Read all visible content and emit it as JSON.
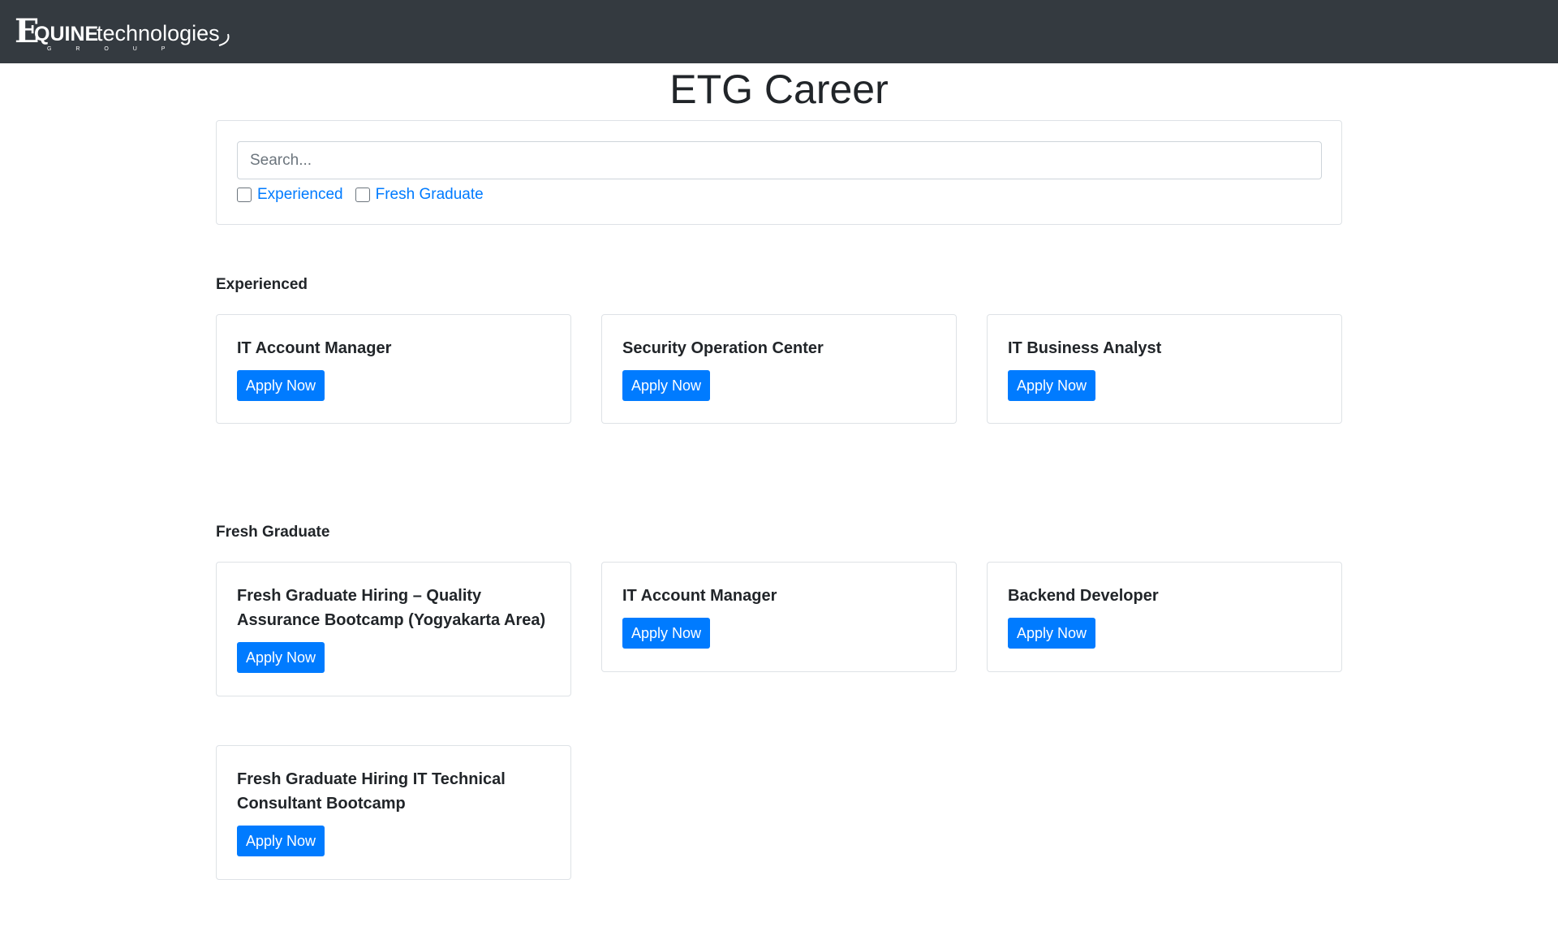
{
  "navbar": {
    "logo_text_bold": "QUINE",
    "logo_text_light": "technologies",
    "logo_subtext": "G R O U P",
    "logo_letter": "E"
  },
  "page": {
    "title": "ETG Career"
  },
  "search": {
    "placeholder": "Search...",
    "value": ""
  },
  "filters": [
    {
      "label": "Experienced",
      "checked": false
    },
    {
      "label": "Fresh Graduate",
      "checked": false
    }
  ],
  "sections": [
    {
      "title": "Experienced",
      "jobs": [
        {
          "title": "IT Account Manager",
          "button": "Apply Now"
        },
        {
          "title": "Security Operation Center",
          "button": "Apply Now"
        },
        {
          "title": "IT Business Analyst",
          "button": "Apply Now"
        }
      ]
    },
    {
      "title": "Fresh Graduate",
      "jobs": [
        {
          "title": "Fresh Graduate Hiring – Quality Assurance Bootcamp (Yogyakarta Area)",
          "button": "Apply Now"
        },
        {
          "title": "IT Account Manager",
          "button": "Apply Now"
        },
        {
          "title": "Backend Developer",
          "button": "Apply Now"
        },
        {
          "title": "Fresh Graduate Hiring IT Technical Consultant Bootcamp",
          "button": "Apply Now"
        }
      ]
    }
  ],
  "colors": {
    "navbar_bg": "#343a40",
    "accent": "#007bff",
    "border": "#dee2e6"
  }
}
